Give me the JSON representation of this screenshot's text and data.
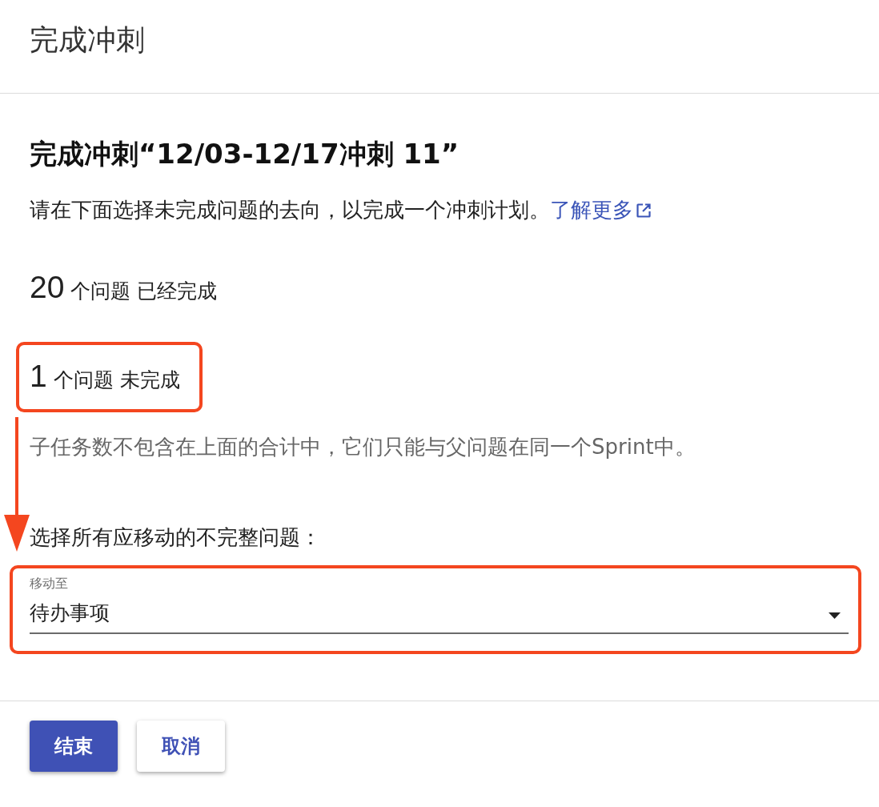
{
  "dialog": {
    "title": "完成冲刺"
  },
  "heading": "完成冲刺“12/03-12/17冲刺 11”",
  "description": {
    "text": "请在下面选择未完成问题的去向，以完成一个冲刺计划。",
    "link": "了解更多"
  },
  "stats": [
    {
      "count": "20",
      "label": "个问题 已经完成",
      "highlighted": false
    },
    {
      "count": "1",
      "label": "个问题 未完成",
      "highlighted": true
    }
  ],
  "note": "子任务数不包含在上面的合计中，它们只能与父问题在同一个Sprint中。",
  "move_prompt": {
    "text": "选择所有应移动的不完整问题：",
    "arrow": true
  },
  "move_to": {
    "label": "移动至",
    "value": "待办事项",
    "highlighted": true
  },
  "buttons": [
    {
      "label": "结束",
      "kind": "primary"
    },
    {
      "label": "取消",
      "kind": "secondary"
    }
  ]
}
